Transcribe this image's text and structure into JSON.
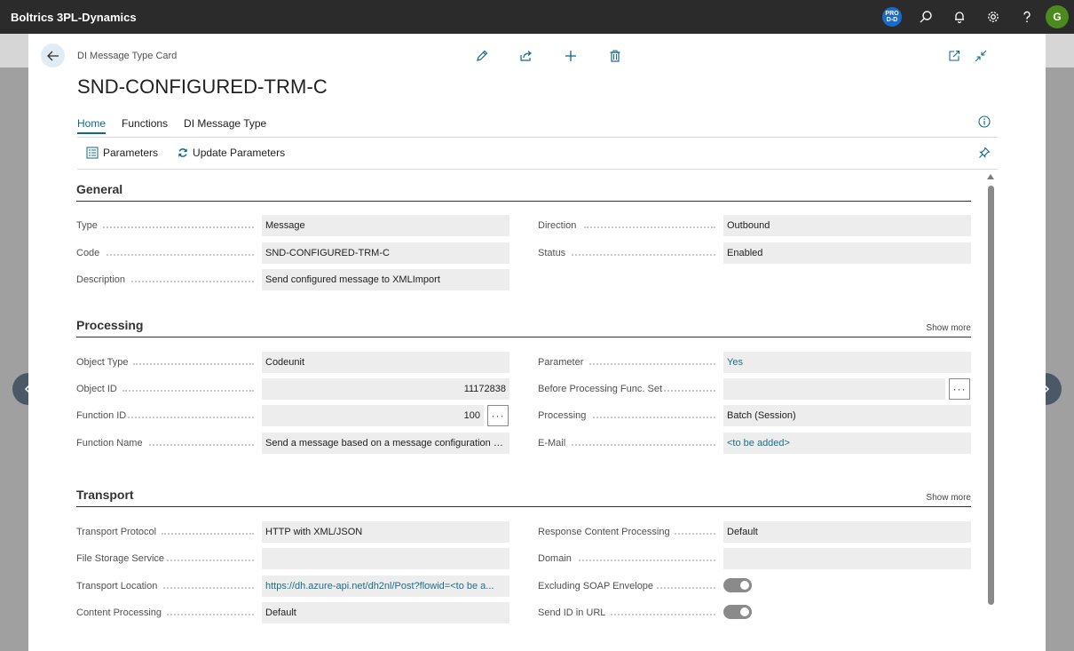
{
  "app": {
    "title": "Boltrics 3PL-Dynamics",
    "badge_line1": "PRO",
    "badge_line2": "D-D",
    "avatar_initial": "G"
  },
  "page": {
    "breadcrumb": "DI Message Type Card",
    "title": "SND-CONFIGURED-TRM-C"
  },
  "tabs": [
    {
      "label": "Home",
      "active": true
    },
    {
      "label": "Functions",
      "active": false
    },
    {
      "label": "DI Message Type",
      "active": false
    }
  ],
  "actions": {
    "parameters": "Parameters",
    "update_parameters": "Update Parameters"
  },
  "general": {
    "title": "General",
    "type": {
      "label": "Type",
      "value": "Message"
    },
    "code": {
      "label": "Code",
      "value": "SND-CONFIGURED-TRM-C"
    },
    "description": {
      "label": "Description",
      "value": "Send configured message to XMLImport"
    },
    "direction": {
      "label": "Direction",
      "value": "Outbound"
    },
    "status": {
      "label": "Status",
      "value": "Enabled"
    }
  },
  "processing": {
    "title": "Processing",
    "show_more": "Show more",
    "object_type": {
      "label": "Object Type",
      "value": "Codeunit"
    },
    "object_id": {
      "label": "Object ID",
      "value": "11172838"
    },
    "function_id": {
      "label": "Function ID",
      "value": "100"
    },
    "function_name": {
      "label": "Function Name",
      "value": "Send a message based on a message configuration c..."
    },
    "parameter": {
      "label": "Parameter",
      "value": "Yes"
    },
    "before_processing": {
      "label": "Before Processing Func. Set",
      "value": ""
    },
    "processing": {
      "label": "Processing",
      "value": "Batch (Session)"
    },
    "email": {
      "label": "E-Mail",
      "value": "<to be added>"
    }
  },
  "transport": {
    "title": "Transport",
    "show_more": "Show more",
    "protocol": {
      "label": "Transport Protocol",
      "value": "HTTP with XML/JSON"
    },
    "file_storage": {
      "label": "File Storage Service",
      "value": ""
    },
    "location": {
      "label": "Transport Location",
      "value": "https://dh.azure-api.net/dh2nl/Post?flowid=<to be a..."
    },
    "content_processing": {
      "label": "Content Processing",
      "value": "Default"
    },
    "response_content": {
      "label": "Response Content Processing",
      "value": "Default"
    },
    "domain": {
      "label": "Domain",
      "value": ""
    },
    "excluding_soap": {
      "label": "Excluding SOAP Envelope",
      "enabled": true
    },
    "send_id": {
      "label": "Send ID in URL",
      "enabled": true
    }
  },
  "colors": {
    "accent": "#0f6a8a",
    "topbar": "#2b2b2b",
    "link": "#1b6f8a"
  }
}
